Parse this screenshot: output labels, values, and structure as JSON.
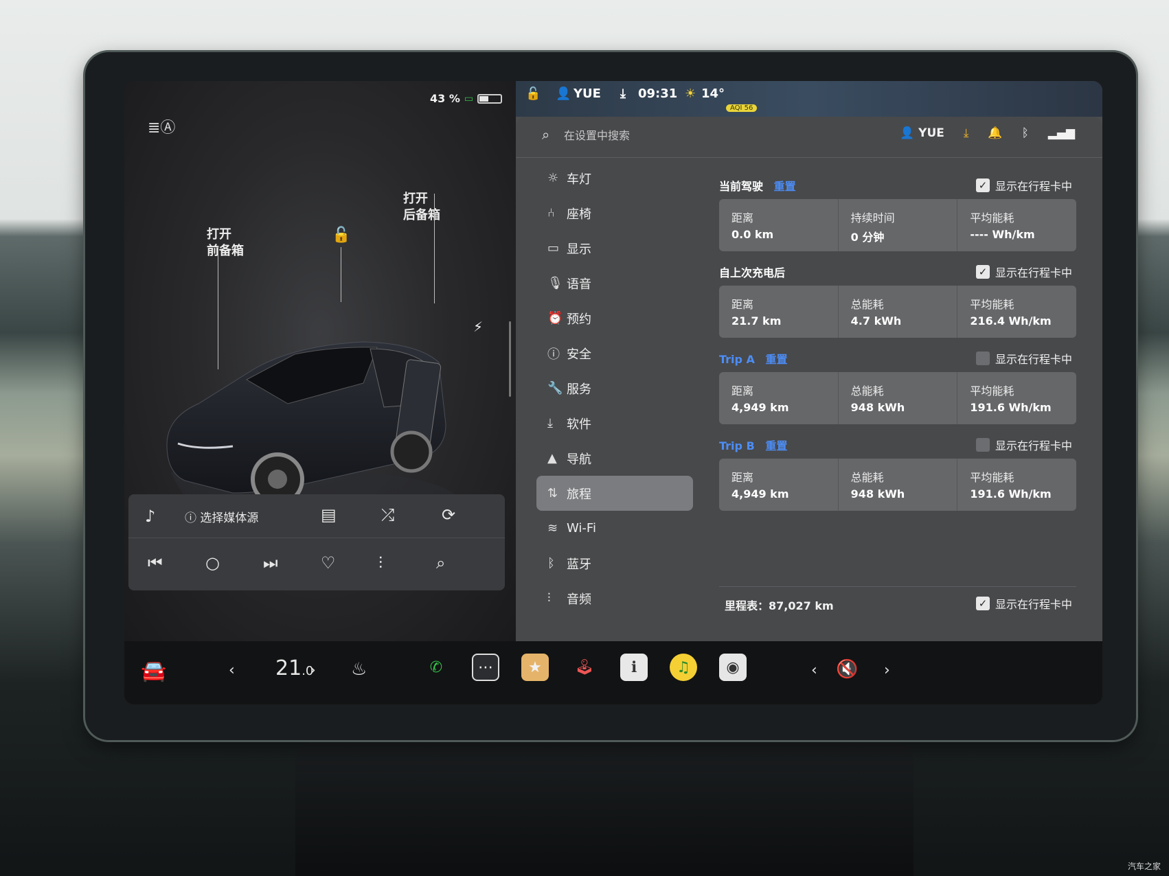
{
  "vehicle": {
    "battery_percent_text": "43 %",
    "battery_level": 0.43,
    "frunk_label_line1": "打开",
    "frunk_label_line2": "前备箱",
    "trunk_label_line1": "打开",
    "trunk_label_line2": "后备箱"
  },
  "status_bar": {
    "user": "YUE",
    "time": "09:31",
    "temperature": "14°",
    "aqi_badge": "AQI 56"
  },
  "media": {
    "source_label": "选择媒体源"
  },
  "search": {
    "placeholder": "在设置中搜索"
  },
  "settings_header": {
    "user": "YUE"
  },
  "menu": {
    "items": [
      {
        "label": "车灯",
        "icon": "sun-icon"
      },
      {
        "label": "座椅",
        "icon": "seat-icon"
      },
      {
        "label": "显示",
        "icon": "display-icon"
      },
      {
        "label": "语音",
        "icon": "mic-icon"
      },
      {
        "label": "预约",
        "icon": "clock-icon"
      },
      {
        "label": "安全",
        "icon": "alert-icon"
      },
      {
        "label": "服务",
        "icon": "wrench-icon"
      },
      {
        "label": "软件",
        "icon": "download-icon"
      },
      {
        "label": "导航",
        "icon": "nav-icon"
      },
      {
        "label": "旅程",
        "icon": "trip-icon"
      },
      {
        "label": "Wi-Fi",
        "icon": "wifi-icon"
      },
      {
        "label": "蓝牙",
        "icon": "bluetooth-icon"
      },
      {
        "label": "音频",
        "icon": "equalizer-icon"
      }
    ],
    "active_index": 9
  },
  "trips": {
    "show_label": "显示在行程卡中",
    "reset_label": "重置",
    "current": {
      "title": "当前驾驶",
      "checked": true,
      "stats": [
        {
          "label": "距离",
          "value": "0.0 km"
        },
        {
          "label": "持续时间",
          "value": "0 分钟"
        },
        {
          "label": "平均能耗",
          "value": "---- Wh/km"
        }
      ]
    },
    "since_charge": {
      "title": "自上次充电后",
      "checked": true,
      "stats": [
        {
          "label": "距离",
          "value": "21.7 km"
        },
        {
          "label": "总能耗",
          "value": "4.7 kWh"
        },
        {
          "label": "平均能耗",
          "value": "216.4 Wh/km"
        }
      ]
    },
    "trip_a": {
      "title": "Trip A",
      "checked": false,
      "stats": [
        {
          "label": "距离",
          "value": "4,949 km"
        },
        {
          "label": "总能耗",
          "value": "948 kWh"
        },
        {
          "label": "平均能耗",
          "value": "191.6 Wh/km"
        }
      ]
    },
    "trip_b": {
      "title": "Trip B",
      "checked": false,
      "stats": [
        {
          "label": "距离",
          "value": "4,949 km"
        },
        {
          "label": "总能耗",
          "value": "948 kWh"
        },
        {
          "label": "平均能耗",
          "value": "191.6 Wh/km"
        }
      ]
    },
    "odometer": {
      "text": "里程表：87,027 km",
      "checked": true
    }
  },
  "bottom_bar": {
    "temp_int": "21",
    "temp_dec": ".0"
  },
  "watermark": "汽车之家",
  "colors": {
    "accent_blue": "#4c8df5",
    "download_yellow": "#f0b429",
    "phone_green": "#36c24a"
  }
}
